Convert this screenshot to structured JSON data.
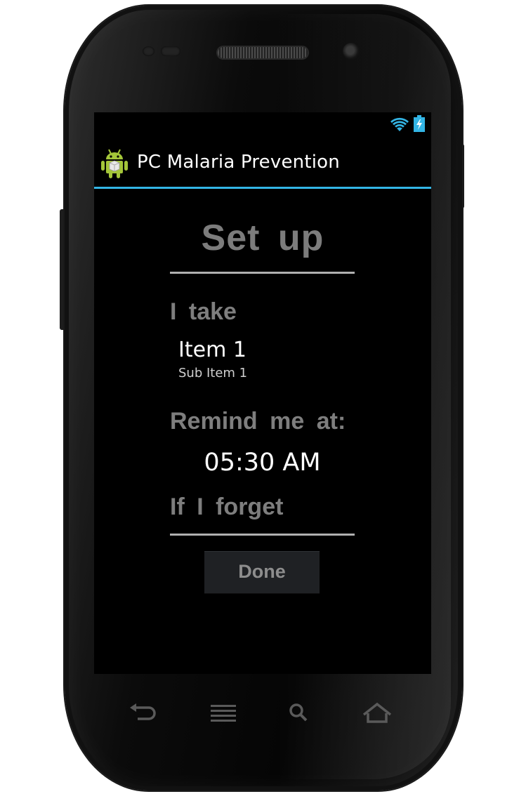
{
  "app": {
    "title": "PC Malaria Prevention",
    "accent_color": "#33b5e5",
    "icon": "android-app-icon"
  },
  "statusbar": {
    "icons": [
      "wifi-icon",
      "battery-charging-icon"
    ]
  },
  "setup": {
    "title": "Set up",
    "take_label": "I take",
    "medication": {
      "title": "Item 1",
      "subtitle": "Sub Item 1"
    },
    "remind_label": "Remind me at:",
    "reminder_time": "05:30 AM",
    "forget_label": "If I forget",
    "done_label": "Done"
  },
  "navigation": {
    "keys": [
      "back-icon",
      "menu-icon",
      "search-icon",
      "home-icon"
    ]
  }
}
